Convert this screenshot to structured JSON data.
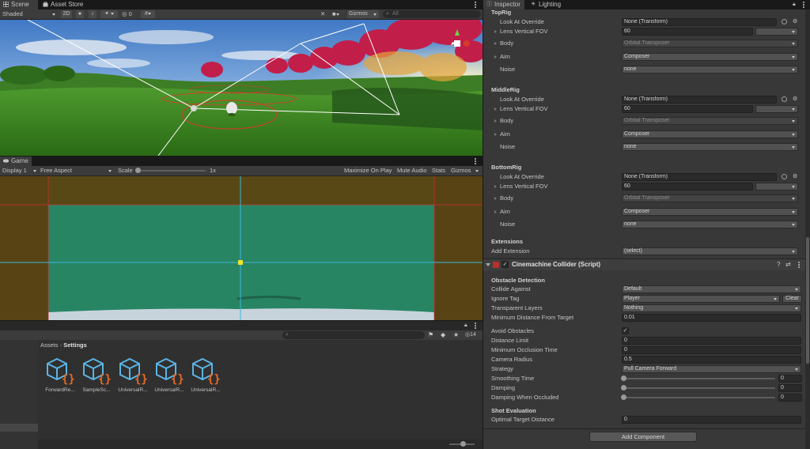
{
  "scene": {
    "tabs": [
      {
        "label": "Scene",
        "icon": "grid-icon"
      },
      {
        "label": "Asset Store",
        "icon": "store-icon"
      }
    ],
    "toolbar": {
      "shading": "Shaded",
      "mode2d": "2D",
      "overlay_count": "0",
      "gizmos": "Gizmos",
      "search_placeholder": "All"
    }
  },
  "game": {
    "tab": "Game",
    "display": "Display 1",
    "aspect": "Free Aspect",
    "scale_label": "Scale",
    "scale_value": "1x",
    "maximize": "Maximize On Play",
    "mute": "Mute Audio",
    "stats": "Stats",
    "gizmos": "Gizmos"
  },
  "project": {
    "visible_count": "14",
    "breadcrumb": [
      "Assets",
      "Settings"
    ],
    "assets": [
      "ForwardRe...",
      "SampleSc...",
      "UniversalR...",
      "UniversalR...",
      "UniversalR..."
    ]
  },
  "inspector": {
    "tabs": [
      {
        "label": "Inspector",
        "icon": "info-icon"
      },
      {
        "label": "Lighting",
        "icon": "bulb-icon"
      }
    ],
    "rigs": [
      {
        "name": "TopRig",
        "look_at_label": "Look At Override",
        "look_at": "None (Transform)",
        "fov_label": "Lens Vertical FOV",
        "fov": "60",
        "body_label": "Body",
        "body": "Orbital Transposer",
        "aim_label": "Aim",
        "aim": "Composer",
        "noise_label": "Noise",
        "noise": "none"
      },
      {
        "name": "MiddleRig",
        "look_at_label": "Look At Override",
        "look_at": "None (Transform)",
        "fov_label": "Lens Vertical FOV",
        "fov": "60",
        "body_label": "Body",
        "body": "Orbital Transposer",
        "aim_label": "Aim",
        "aim": "Composer",
        "noise_label": "Noise",
        "noise": "none"
      },
      {
        "name": "BottomRig",
        "look_at_label": "Look At Override",
        "look_at": "None (Transform)",
        "fov_label": "Lens Vertical FOV",
        "fov": "60",
        "body_label": "Body",
        "body": "Orbital Transposer",
        "aim_label": "Aim",
        "aim": "Composer",
        "noise_label": "Noise",
        "noise": "none"
      }
    ],
    "extensions": {
      "header": "Extensions",
      "add_label": "Add Extension",
      "add_value": "(select)"
    },
    "collider": {
      "title": "Cinemachine Collider (Script)",
      "obstacle_header": "Obstacle Detection",
      "collide_against_label": "Collide Against",
      "collide_against": "Default",
      "ignore_tag_label": "Ignore Tag",
      "ignore_tag": "Player",
      "clear": "Clear",
      "transparent_label": "Transparent Layers",
      "transparent": "Nothing",
      "min_dist_label": "Minimum Distance From Target",
      "min_dist": "0.01",
      "avoid_label": "Avoid Obstacles",
      "avoid_check": "✓",
      "dist_limit_label": "Distance Limit",
      "dist_limit": "0",
      "min_occ_label": "Minimum Occlusion Time",
      "min_occ": "0",
      "radius_label": "Camera Radius",
      "radius": "0.5",
      "strategy_label": "Strategy",
      "strategy": "Pull Camera Forward",
      "smoothing_label": "Smoothing Time",
      "smoothing": "0",
      "damping_label": "Damping",
      "damping": "0",
      "damping_occ_label": "Damping When Occluded",
      "damping_occ": "0",
      "shot_header": "Shot Evaluation",
      "optimal_label": "Optimal Target Distance",
      "optimal": "0"
    },
    "add_component": "Add Component"
  },
  "colors": {
    "game_overlay": "#2f8a63",
    "panel": "#383838",
    "accent_red": "#d83a2a"
  }
}
